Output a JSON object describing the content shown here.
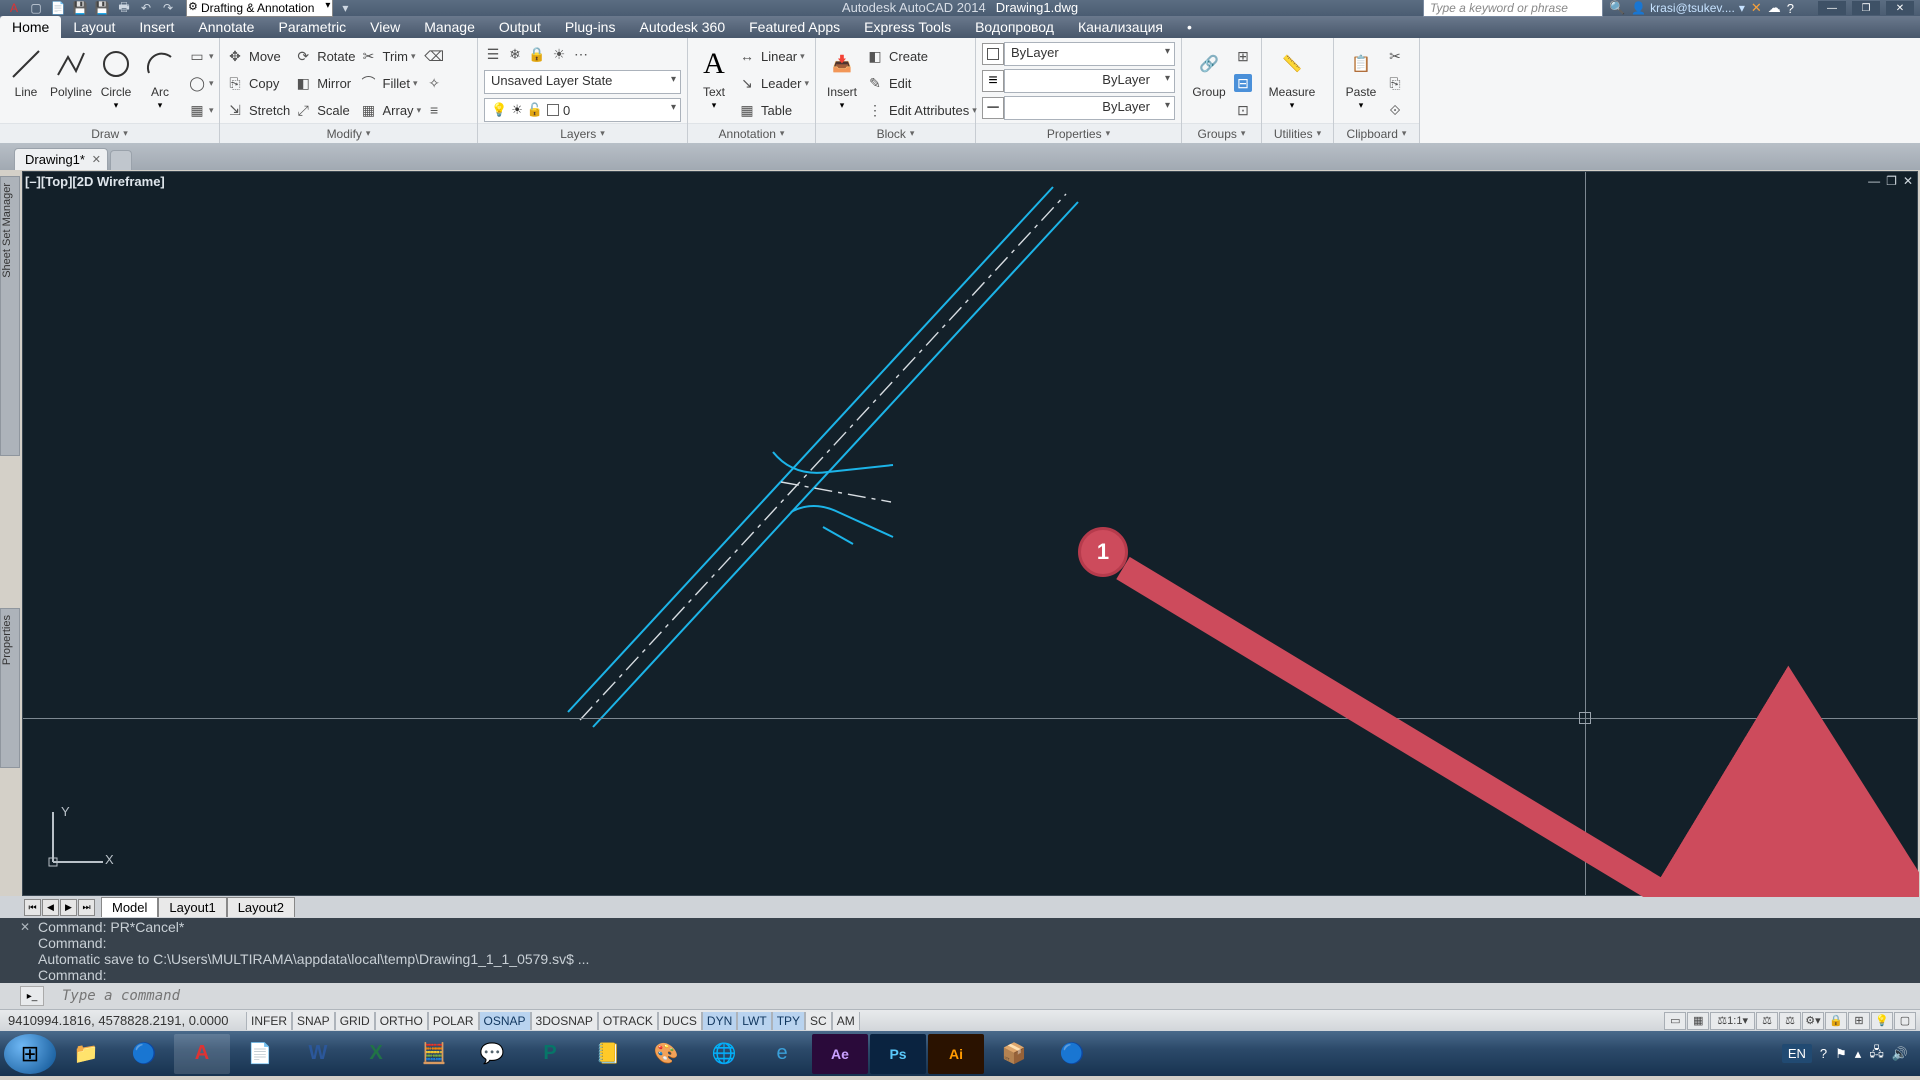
{
  "app": {
    "name": "Autodesk AutoCAD 2014",
    "document": "Drawing1.dwg"
  },
  "qat_workspace": "Drafting & Annotation",
  "search_placeholder": "Type a keyword or phrase",
  "user": "krasi@tsukev....",
  "menu": [
    "Home",
    "Layout",
    "Insert",
    "Annotate",
    "Parametric",
    "View",
    "Manage",
    "Output",
    "Plug-ins",
    "Autodesk 360",
    "Featured Apps",
    "Express Tools",
    "Водопровод",
    "Канализация"
  ],
  "active_menu": "Home",
  "ribbon": {
    "draw": {
      "title": "Draw",
      "items": [
        "Line",
        "Polyline",
        "Circle",
        "Arc"
      ]
    },
    "modify": {
      "title": "Modify",
      "c1": [
        "Move",
        "Copy",
        "Stretch"
      ],
      "c2": [
        "Rotate",
        "Mirror",
        "Scale"
      ],
      "c3": [
        "Trim",
        "Fillet",
        "Array"
      ]
    },
    "layers": {
      "title": "Layers",
      "state": "Unsaved Layer State",
      "current": "0"
    },
    "annotation": {
      "title": "Annotation",
      "text": "Text",
      "items": [
        "Linear",
        "Leader",
        "Table"
      ]
    },
    "block": {
      "title": "Block",
      "insert": "Insert",
      "items": [
        "Create",
        "Edit",
        "Edit Attributes"
      ]
    },
    "properties": {
      "title": "Properties",
      "rows": [
        "ByLayer",
        "ByLayer",
        "ByLayer"
      ]
    },
    "groups": {
      "title": "Groups",
      "label": "Group"
    },
    "utilities": {
      "title": "Utilities",
      "label": "Measure"
    },
    "clipboard": {
      "title": "Clipboard",
      "label": "Paste"
    }
  },
  "doc_tab": "Drawing1*",
  "viewport_label": "[–][Top][2D Wireframe]",
  "annotation_badge": "1",
  "side_rails": {
    "top": "Sheet Set Manager",
    "bottom": "Properties"
  },
  "layout_tabs": [
    "Model",
    "Layout1",
    "Layout2"
  ],
  "command_history": [
    "Command: PR*Cancel*",
    "Command:",
    "Automatic save to C:\\Users\\MULTIRAMA\\appdata\\local\\temp\\Drawing1_1_1_0579.sv$ ...",
    "Command:"
  ],
  "command_placeholder": "Type a command",
  "coords": "9410994.1816, 4578828.2191, 0.0000",
  "toggles": [
    {
      "l": "INFER",
      "on": false
    },
    {
      "l": "SNAP",
      "on": false
    },
    {
      "l": "GRID",
      "on": false
    },
    {
      "l": "ORTHO",
      "on": false
    },
    {
      "l": "POLAR",
      "on": false
    },
    {
      "l": "OSNAP",
      "on": true
    },
    {
      "l": "3DOSNAP",
      "on": false
    },
    {
      "l": "OTRACK",
      "on": false
    },
    {
      "l": "DUCS",
      "on": false
    },
    {
      "l": "DYN",
      "on": true
    },
    {
      "l": "LWT",
      "on": true
    },
    {
      "l": "TPY",
      "on": true
    },
    {
      "l": "SC",
      "on": false
    },
    {
      "l": "AM",
      "on": false
    }
  ],
  "scale_label": "1:1",
  "tray": {
    "lang": "EN",
    "time": ""
  },
  "colors": {
    "canvas": "#132029",
    "road": "#1cb4e8",
    "center": "#d8dde2",
    "accent": "#cd4b5c"
  }
}
